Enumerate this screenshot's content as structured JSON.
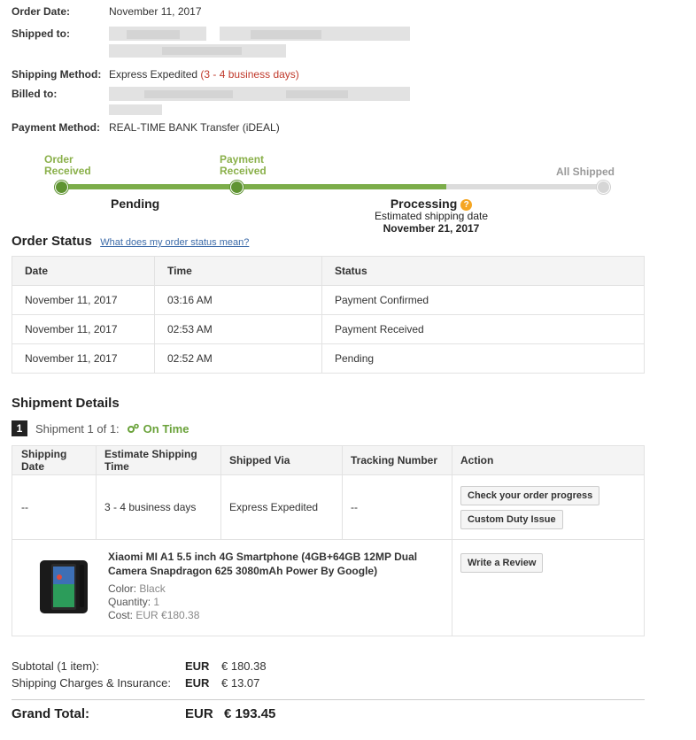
{
  "order": {
    "date_label": "Order Date:",
    "date_value": "November 11, 2017",
    "shipped_to_label": "Shipped to:",
    "shipping_method_label": "Shipping Method:",
    "shipping_method_value": "Express Expedited",
    "shipping_method_days": "(3 - 4 business days)",
    "billed_to_label": "Billed to:",
    "payment_method_label": "Payment Method:",
    "payment_method_value": "REAL-TIME BANK Transfer (iDEAL)"
  },
  "progress": {
    "step1_line1": "Order",
    "step1_line2": "Received",
    "step2_line1": "Payment",
    "step2_line2": "Received",
    "step3": "All Shipped",
    "pending": "Pending",
    "processing": "Processing",
    "processing_icon": "?",
    "est_label": "Estimated shipping date",
    "est_date": "November 21, 2017",
    "fill_fraction": 0.71
  },
  "order_status": {
    "title": "Order Status",
    "help_link": "What does my order status mean?",
    "columns": [
      "Date",
      "Time",
      "Status"
    ],
    "rows": [
      [
        "November 11, 2017",
        "03:16 AM",
        "Payment Confirmed"
      ],
      [
        "November 11, 2017",
        "02:53 AM",
        "Payment Received"
      ],
      [
        "November 11, 2017",
        "02:52 AM",
        "Pending"
      ]
    ]
  },
  "shipment": {
    "title": "Shipment Details",
    "number": "1",
    "label": "Shipment 1 of 1:",
    "on_time": "On Time",
    "columns": [
      "Shipping Date",
      "Estimate Shipping Time",
      "Shipped Via",
      "Tracking Number",
      "Action"
    ],
    "row": [
      "--",
      "3 - 4 business days",
      "Express Expedited",
      "--"
    ],
    "btn_progress": "Check your order progress",
    "btn_duty": "Custom Duty Issue",
    "product": {
      "name": "Xiaomi MI A1 5.5 inch 4G Smartphone (4GB+64GB 12MP Dual Camera Snapdragon 625 3080mAh Power By Google)",
      "color_label": "Color:",
      "color_value": "Black",
      "qty_label": "Quantity:",
      "qty_value": "1",
      "cost_label": "Cost:",
      "cost_value": "EUR €180.38",
      "btn_review": "Write a Review"
    }
  },
  "totals": {
    "subtotal_label": "Subtotal (1 item):",
    "subtotal_cur": "EUR",
    "subtotal_val": "€ 180.38",
    "shipping_label": "Shipping Charges & Insurance:",
    "shipping_cur": "EUR",
    "shipping_val": "€ 13.07",
    "grand_label": "Grand Total:",
    "grand_cur": "EUR",
    "grand_val": "€ 193.45"
  },
  "colors": {
    "green": "#7cad4a",
    "red": "#c0392b",
    "link": "#3b6aa8"
  }
}
